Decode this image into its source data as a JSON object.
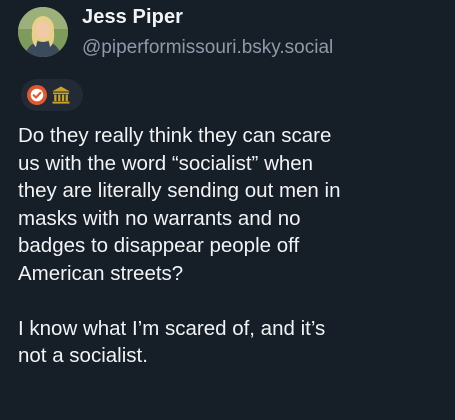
{
  "profile": {
    "display_name": "Jess Piper",
    "handle": "@piperformissouri.bsky.social",
    "avatar_icon": "profile-photo"
  },
  "badges": [
    {
      "icon": "verified-check-icon",
      "color": "#e4572e"
    },
    {
      "icon": "government-building-icon",
      "color": "#c9a227"
    }
  ],
  "post": {
    "paragraphs": [
      "Do they really think they can scare\nus with the word “socialist” when\nthey are literally sending out men in\nmasks with no warrants and no\nbadges to disappear people off\nAmerican streets?",
      "I know what I’m scared of, and it’s\nnot a socialist."
    ]
  }
}
